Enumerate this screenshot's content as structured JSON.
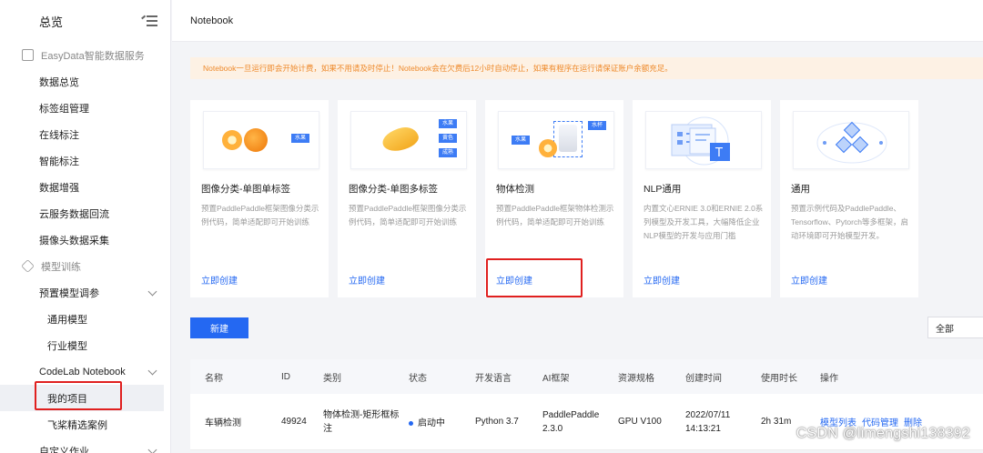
{
  "sidebar": {
    "overview": "总览",
    "sections": [
      {
        "label": "EasyData智能数据服务",
        "items": [
          "数据总览",
          "标签组管理",
          "在线标注",
          "智能标注",
          "数据增强",
          "云服务数据回流",
          "摄像头数据采集"
        ]
      }
    ],
    "model_training": "模型训练",
    "preset_tuning": "预置模型调参",
    "general_model": "通用模型",
    "industry_model": "行业模型",
    "codelab": "CodeLab Notebook",
    "my_projects": "我的项目",
    "paddle_cases": "飞桨精选案例",
    "custom_job": "自定义作业"
  },
  "topbar": {
    "title": "Notebook"
  },
  "notice": "Notebook一旦运行即会开始计费，如果不用请及时停止！Notebook会在欠费后12小时自动停止，如果有程序在运行请保证账户余额充足。",
  "cards": [
    {
      "title": "图像分类-单图单标签",
      "desc": "预置PaddlePaddle框架图像分类示例代码，简单适配即可开始训练",
      "create": "立即创建",
      "tags": [
        "水果"
      ]
    },
    {
      "title": "图像分类-单图多标签",
      "desc": "预置PaddlePaddle框架图像分类示例代码，简单适配即可开始训练",
      "create": "立即创建",
      "tags": [
        "水果",
        "黄色",
        "成熟"
      ]
    },
    {
      "title": "物体检测",
      "desc": "预置PaddlePaddle框架物体检测示例代码，简单适配即可开始训练",
      "create": "立即创建",
      "tags": [
        "水杯",
        "水果"
      ]
    },
    {
      "title": "NLP通用",
      "desc": "内置文心ERNIE 3.0和ERNIE 2.0系列模型及开发工具，大幅降低企业NLP模型的开发与应用门槛",
      "create": "立即创建",
      "tags": []
    },
    {
      "title": "通用",
      "desc": "预置示例代码及PaddlePaddle、Tensorflow、Pytorch等多框架，启动环境即可开始模型开发。",
      "create": "立即创建",
      "tags": []
    }
  ],
  "new_button": "新建",
  "filter": {
    "selected": "全部"
  },
  "table": {
    "headers": [
      "名称",
      "ID",
      "类别",
      "状态",
      "开发语言",
      "AI框架",
      "资源规格",
      "创建时间",
      "使用时长",
      "操作"
    ],
    "rows": [
      {
        "name": "车辆检测",
        "id": "49924",
        "category": "物体检测-矩形框标注",
        "status": "启动中",
        "lang": "Python 3.7",
        "framework": "PaddlePaddle 2.3.0",
        "spec": "GPU V100",
        "created": "2022/07/11 14:13:21",
        "duration": "2h 31m",
        "actions": [
          "模型列表",
          "代码管理",
          "删除"
        ]
      }
    ]
  },
  "watermark": "CSDN @limengshi138392",
  "colors": {
    "accent": "#2468f2",
    "highlight": "#e0201f",
    "notice_bg": "#fdf1e4",
    "notice_text": "#ee8a2c"
  }
}
